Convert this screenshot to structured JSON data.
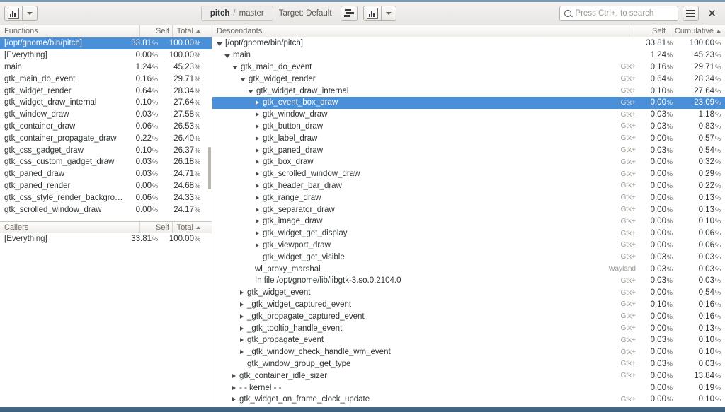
{
  "header": {
    "project": "pitch",
    "separator": "/",
    "branch": "master",
    "target_label": "Target: Default",
    "search_placeholder": "Press Ctrl+. to search",
    "icons": {
      "graph": "chart-icon",
      "dropdown": "chevron-down-icon",
      "stacked_bars": "stacked-bars-icon",
      "menu": "hamburger-menu-icon",
      "close": "close-icon",
      "search": "search-icon"
    }
  },
  "left_pane": {
    "functions_header": {
      "name": "Functions",
      "self": "Self",
      "total": "Total"
    },
    "callers_header": {
      "name": "Callers",
      "self": "Self",
      "total": "Total"
    },
    "functions": [
      {
        "name": "[/opt/gnome/bin/pitch]",
        "self": "33.81",
        "total": "100.00",
        "selected": true
      },
      {
        "name": "[Everything]",
        "self": "0.00",
        "total": "100.00",
        "selected": false
      },
      {
        "name": "main",
        "self": "1.24",
        "total": "45.23",
        "selected": false
      },
      {
        "name": "gtk_main_do_event",
        "self": "0.16",
        "total": "29.71",
        "selected": false
      },
      {
        "name": "gtk_widget_render",
        "self": "0.64",
        "total": "28.34",
        "selected": false
      },
      {
        "name": "gtk_widget_draw_internal",
        "self": "0.10",
        "total": "27.64",
        "selected": false
      },
      {
        "name": "gtk_window_draw",
        "self": "0.03",
        "total": "27.58",
        "selected": false
      },
      {
        "name": "gtk_container_draw",
        "self": "0.06",
        "total": "26.53",
        "selected": false
      },
      {
        "name": "gtk_container_propagate_draw",
        "self": "0.22",
        "total": "26.40",
        "selected": false
      },
      {
        "name": "gtk_css_gadget_draw",
        "self": "0.10",
        "total": "26.37",
        "selected": false
      },
      {
        "name": "gtk_css_custom_gadget_draw",
        "self": "0.03",
        "total": "26.18",
        "selected": false
      },
      {
        "name": "gtk_paned_draw",
        "self": "0.03",
        "total": "24.71",
        "selected": false
      },
      {
        "name": "gtk_paned_render",
        "self": "0.00",
        "total": "24.68",
        "selected": false
      },
      {
        "name": "gtk_css_style_render_background",
        "self": "0.06",
        "total": "24.33",
        "selected": false
      },
      {
        "name": "gtk_scrolled_window_draw",
        "self": "0.00",
        "total": "24.17",
        "selected": false
      }
    ],
    "callers": [
      {
        "name": "[Everything]",
        "self": "33.81",
        "total": "100.00"
      }
    ]
  },
  "right_pane": {
    "headers": {
      "descendants": "Descendants",
      "self": "Self",
      "cumulative": "Cumulative"
    },
    "rows": [
      {
        "name": "[/opt/gnome/bin/pitch]",
        "depth": 0,
        "expander": "open",
        "tag": "",
        "self": "33.81",
        "cum": "100.00",
        "selected": false
      },
      {
        "name": "main",
        "depth": 1,
        "expander": "open",
        "tag": "",
        "self": "1.24",
        "cum": "45.23",
        "selected": false
      },
      {
        "name": "gtk_main_do_event",
        "depth": 2,
        "expander": "open",
        "tag": "Gtk+",
        "self": "0.16",
        "cum": "29.71",
        "selected": false
      },
      {
        "name": "gtk_widget_render",
        "depth": 3,
        "expander": "open",
        "tag": "Gtk+",
        "self": "0.64",
        "cum": "28.34",
        "selected": false
      },
      {
        "name": "gtk_widget_draw_internal",
        "depth": 4,
        "expander": "open",
        "tag": "Gtk+",
        "self": "0.10",
        "cum": "27.64",
        "selected": false
      },
      {
        "name": "gtk_event_box_draw",
        "depth": 5,
        "expander": "closed",
        "tag": "Gtk+",
        "self": "0.00",
        "cum": "23.09",
        "selected": true
      },
      {
        "name": "gtk_window_draw",
        "depth": 5,
        "expander": "closed",
        "tag": "Gtk+",
        "self": "0.03",
        "cum": "1.18",
        "selected": false
      },
      {
        "name": "gtk_button_draw",
        "depth": 5,
        "expander": "closed",
        "tag": "Gtk+",
        "self": "0.03",
        "cum": "0.83",
        "selected": false
      },
      {
        "name": "gtk_label_draw",
        "depth": 5,
        "expander": "closed",
        "tag": "Gtk+",
        "self": "0.00",
        "cum": "0.57",
        "selected": false
      },
      {
        "name": "gtk_paned_draw",
        "depth": 5,
        "expander": "closed",
        "tag": "Gtk+",
        "self": "0.03",
        "cum": "0.54",
        "selected": false
      },
      {
        "name": "gtk_box_draw",
        "depth": 5,
        "expander": "closed",
        "tag": "Gtk+",
        "self": "0.00",
        "cum": "0.32",
        "selected": false
      },
      {
        "name": "gtk_scrolled_window_draw",
        "depth": 5,
        "expander": "closed",
        "tag": "Gtk+",
        "self": "0.00",
        "cum": "0.29",
        "selected": false
      },
      {
        "name": "gtk_header_bar_draw",
        "depth": 5,
        "expander": "closed",
        "tag": "Gtk+",
        "self": "0.00",
        "cum": "0.22",
        "selected": false
      },
      {
        "name": "gtk_range_draw",
        "depth": 5,
        "expander": "closed",
        "tag": "Gtk+",
        "self": "0.00",
        "cum": "0.13",
        "selected": false
      },
      {
        "name": "gtk_separator_draw",
        "depth": 5,
        "expander": "closed",
        "tag": "Gtk+",
        "self": "0.00",
        "cum": "0.13",
        "selected": false
      },
      {
        "name": "gtk_image_draw",
        "depth": 5,
        "expander": "closed",
        "tag": "Gtk+",
        "self": "0.00",
        "cum": "0.10",
        "selected": false
      },
      {
        "name": "gtk_widget_get_display",
        "depth": 5,
        "expander": "closed",
        "tag": "Gtk+",
        "self": "0.00",
        "cum": "0.06",
        "selected": false
      },
      {
        "name": "gtk_viewport_draw",
        "depth": 5,
        "expander": "closed",
        "tag": "Gtk+",
        "self": "0.00",
        "cum": "0.06",
        "selected": false
      },
      {
        "name": "gtk_widget_get_visible",
        "depth": 5,
        "expander": "none",
        "tag": "Gtk+",
        "self": "0.03",
        "cum": "0.03",
        "selected": false
      },
      {
        "name": "wl_proxy_marshal",
        "depth": 4,
        "expander": "none",
        "tag": "Wayland",
        "self": "0.03",
        "cum": "0.03",
        "selected": false
      },
      {
        "name": "In file /opt/gnome/lib/libgtk-3.so.0.2104.0",
        "depth": 4,
        "expander": "none",
        "tag": "Gtk+",
        "self": "0.03",
        "cum": "0.03",
        "selected": false
      },
      {
        "name": "gtk_widget_event",
        "depth": 3,
        "expander": "closed",
        "tag": "Gtk+",
        "self": "0.00",
        "cum": "0.54",
        "selected": false
      },
      {
        "name": "_gtk_widget_captured_event",
        "depth": 3,
        "expander": "closed",
        "tag": "Gtk+",
        "self": "0.10",
        "cum": "0.16",
        "selected": false
      },
      {
        "name": "_gtk_propagate_captured_event",
        "depth": 3,
        "expander": "closed",
        "tag": "Gtk+",
        "self": "0.00",
        "cum": "0.16",
        "selected": false
      },
      {
        "name": "_gtk_tooltip_handle_event",
        "depth": 3,
        "expander": "closed",
        "tag": "Gtk+",
        "self": "0.00",
        "cum": "0.13",
        "selected": false
      },
      {
        "name": "gtk_propagate_event",
        "depth": 3,
        "expander": "closed",
        "tag": "Gtk+",
        "self": "0.03",
        "cum": "0.10",
        "selected": false
      },
      {
        "name": "_gtk_window_check_handle_wm_event",
        "depth": 3,
        "expander": "closed",
        "tag": "Gtk+",
        "self": "0.00",
        "cum": "0.10",
        "selected": false
      },
      {
        "name": "gtk_window_group_get_type",
        "depth": 3,
        "expander": "none",
        "tag": "Gtk+",
        "self": "0.03",
        "cum": "0.03",
        "selected": false
      },
      {
        "name": "gtk_container_idle_sizer",
        "depth": 2,
        "expander": "closed",
        "tag": "Gtk+",
        "self": "0.00",
        "cum": "13.84",
        "selected": false
      },
      {
        "name": "- - kernel - -",
        "depth": 2,
        "expander": "closed",
        "tag": "",
        "self": "0.00",
        "cum": "0.19",
        "selected": false
      },
      {
        "name": "gtk_widget_on_frame_clock_update",
        "depth": 2,
        "expander": "closed",
        "tag": "Gtk+",
        "self": "0.00",
        "cum": "0.10",
        "selected": false
      }
    ]
  },
  "colors": {
    "selection": "#4a90d9",
    "header_bg": "#ece9e6",
    "desktop": "#4d7192"
  }
}
